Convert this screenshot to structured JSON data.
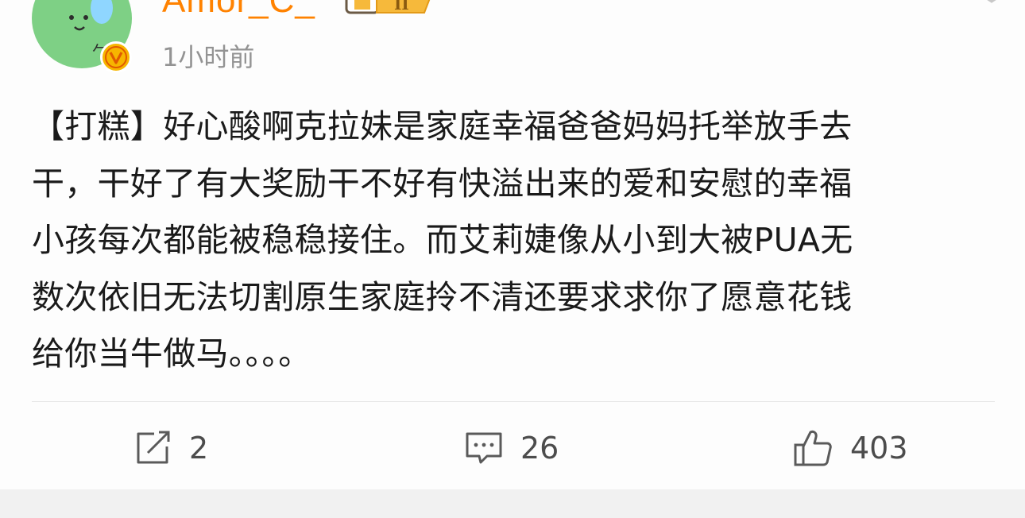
{
  "header": {
    "username": "Amor_C_",
    "timestamp": "1小时前",
    "level_badge_text": "II",
    "avatar_text": "𠂉"
  },
  "post": {
    "lines": [
      "【打糕】好心酸啊克拉妹是家庭幸福爸爸妈妈托举放手去",
      "干，干好了有大奖励干不好有快溢出来的爱和安慰的幸福",
      "小孩每次都能被稳稳接住。而艾莉婕像从小到大被PUA无",
      "数次依旧无法切割原生家庭拎不清还要求求你了愿意花钱",
      "给你当牛做马。。。。"
    ]
  },
  "actions": {
    "repost": {
      "icon": "repost-icon",
      "count": "2"
    },
    "comment": {
      "icon": "comment-icon",
      "count": "26"
    },
    "like": {
      "icon": "thumbs-up-icon",
      "count": "403"
    }
  },
  "colors": {
    "username": "#ff8200",
    "timestamp": "#939393",
    "text": "#1a1a1a",
    "avatar": "#7ed085",
    "verified": "#f7b500"
  }
}
